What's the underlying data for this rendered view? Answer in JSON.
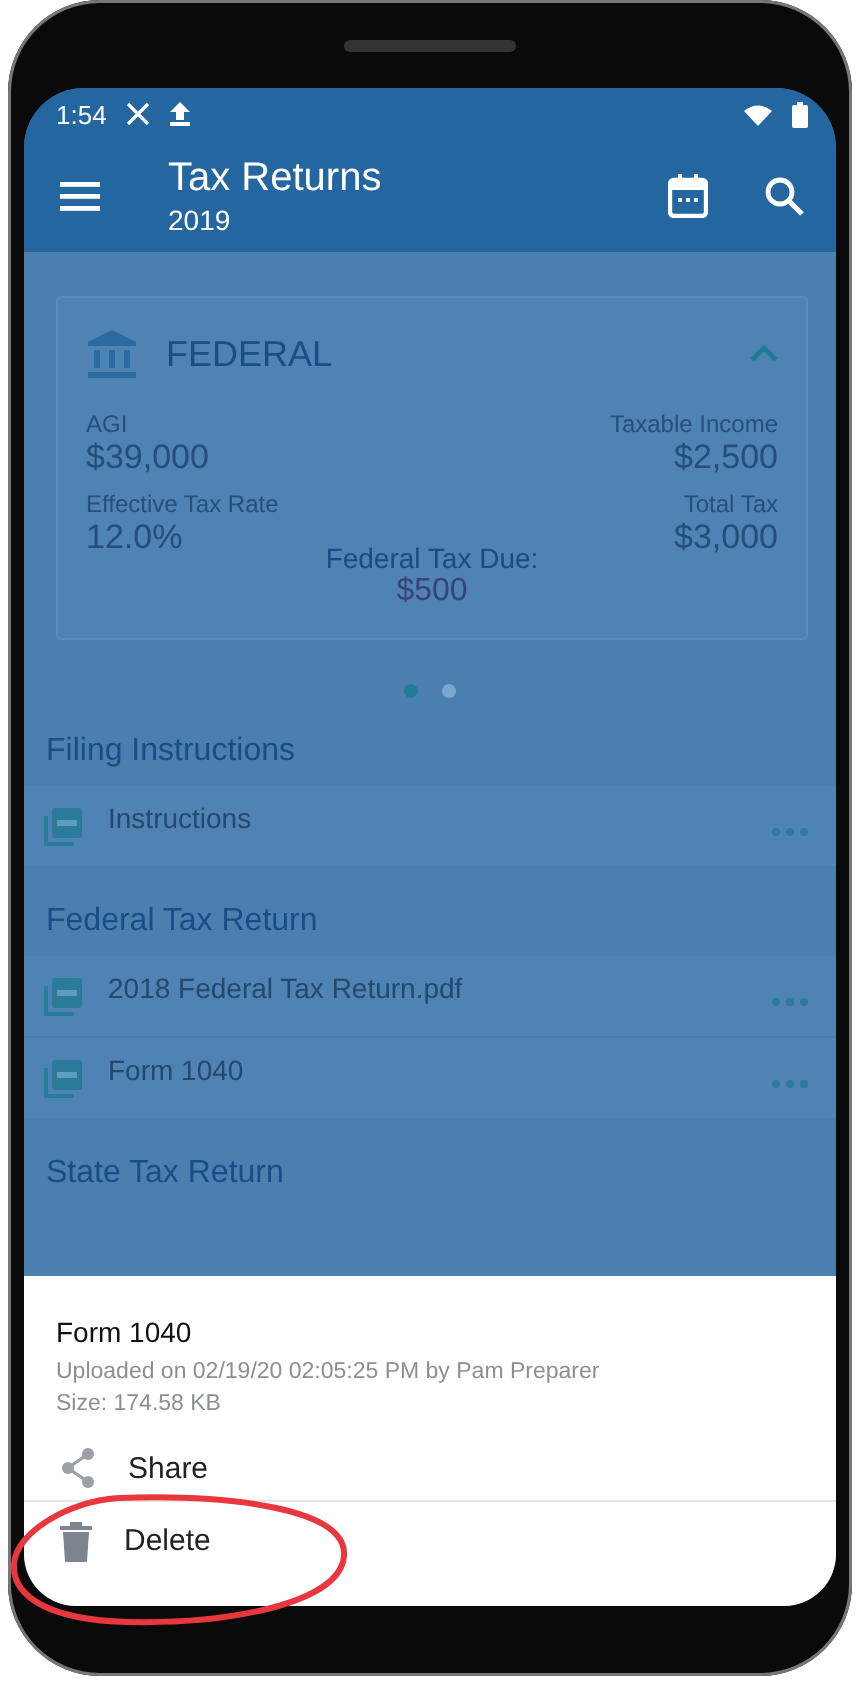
{
  "status_bar": {
    "time": "1:54"
  },
  "app_bar": {
    "title": "Tax Returns",
    "subtitle": "2019"
  },
  "summary_card": {
    "title": "FEDERAL",
    "expanded": true,
    "stats": [
      {
        "label": "AGI",
        "value": "$39,000"
      },
      {
        "label": "Taxable Income",
        "value": "$2,500"
      },
      {
        "label": "Effective Tax Rate",
        "value": "12.0%"
      },
      {
        "label": "Total Tax",
        "value": "$3,000"
      }
    ],
    "due_label": "Federal Tax Due:",
    "due_amount": "$500"
  },
  "pager_dots": [
    {
      "selected": true
    },
    {
      "selected": false
    }
  ],
  "sections": [
    {
      "title": "Filing Instructions",
      "files": [
        {
          "name": "Instructions"
        }
      ]
    },
    {
      "title": "Federal Tax Return",
      "files": [
        {
          "name": "2018 Federal Tax Return.pdf"
        },
        {
          "name": "Form 1040"
        }
      ]
    },
    {
      "title": "State Tax Return"
    }
  ],
  "bottom_sheet": {
    "title": "Form 1040",
    "uploaded": "Uploaded on 02/19/20 02:05:25 PM by Pam Preparer",
    "size": "Size: 174.58 KB",
    "actions": [
      {
        "kind": "share",
        "label": "Share"
      },
      {
        "kind": "delete",
        "label": "Delete"
      }
    ]
  },
  "annotation": {
    "kind": "ellipse"
  }
}
